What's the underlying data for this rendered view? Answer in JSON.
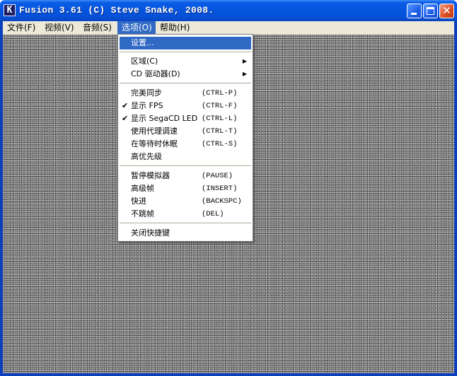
{
  "window": {
    "title": "Fusion 3.61 (C) Steve Snake, 2008."
  },
  "menubar": {
    "items": [
      {
        "label": "文件(F)"
      },
      {
        "label": "视频(V)"
      },
      {
        "label": "音频(S)"
      },
      {
        "label": "选项(O)"
      },
      {
        "label": "帮助(H)"
      }
    ]
  },
  "options_menu": {
    "settings": "设置...",
    "region": "区域(C)",
    "cd_drive": "CD 驱动器(D)",
    "perfect_sync": {
      "label": "完美同步",
      "shortcut": "(CTRL-P)"
    },
    "show_fps": {
      "label": "显示 FPS",
      "shortcut": "(CTRL-F)"
    },
    "show_segacd_led": {
      "label": "显示 SegaCD LED",
      "shortcut": "(CTRL-L)"
    },
    "proxy_tweak": {
      "label": "使用代理调速",
      "shortcut": "(CTRL-T)"
    },
    "sleep_wait": {
      "label": "在等待时休眠",
      "shortcut": "(CTRL-S)"
    },
    "high_priority": {
      "label": "高优先级"
    },
    "pause": {
      "label": "暂停模拟器",
      "shortcut": "(PAUSE)"
    },
    "advance_frame": {
      "label": "高级帧",
      "shortcut": "(INSERT)"
    },
    "fast_forward": {
      "label": "快进",
      "shortcut": "(BACKSPC)"
    },
    "no_skip": {
      "label": "不跳帧",
      "shortcut": "(DEL)"
    },
    "disable_hotkeys": {
      "label": "关闭快捷键"
    },
    "check_glyph": "✔",
    "submenu_glyph": "▶"
  },
  "icons": {
    "app": "K",
    "close": "✕"
  }
}
